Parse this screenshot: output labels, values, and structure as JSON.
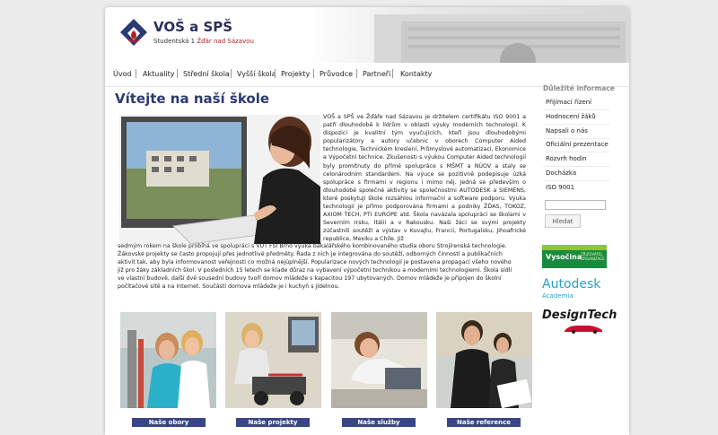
{
  "header": {
    "school_name": "VOŠ a SPŠ",
    "address_street": "Studentská 1",
    "address_town": "Žďár nad Sázavou"
  },
  "nav": [
    "Úvod",
    "Aktuality",
    "Střední škola",
    "Vyšší škola",
    "Projekty",
    "Průvodce",
    "Partneři",
    "Kontakty"
  ],
  "main": {
    "heading": "Vítejte na naší škole",
    "intro_right": "VOŠ a SPŠ ve Žďáře nad Sázavou je držitelem certifikátu ISO 9001 a patří dlouhodobě k lídrům v oblasti výuky moderních technologií. K dispozici je kvalitní tým vyučujících, kteří jsou dlouhodobými popularizátory a autory učebnic v oborech Computer Aided technologie, Technickém kreslení, Průmyslové automatizaci, Ekonomice a Výpočetní technice. Zkušenosti s výukou Computer Aided technologií byly promítnuty do přímé spolupráce s MŠMT a NÚOV a staly se celonárodním standardem. Na výuce se pozitivně podepisuje úzká spolupráce s firmami v regionu i mimo něj. Jedná se především o dlouhodobé společné aktivity se společnostmi AUTODESK a SIEMENS, které poskytují škole rozsáhlou informační a software podporu. Výuka technologií je přímo podporována firmami a podniky ŽĎAS, TOKOZ, AXIOM TECH, PTI EUROPE atd. Škola navázala spolupráci se školami v Severním Irsku, Itálii a v Rakousku. Naši žáci se svými projekty zúčastnili soutěží a výstav v Kuvajtu, Francii, Portugalsku, Jihoafrické republice, Mexiku a Chile. Již",
    "intro_full_lines": [
      "sedmým rokem na škole probíhá ve spolupráci s VUT FSI Brno výuka bakalářského kombinovaného studia oboru Strojírenská technologie.",
      "Žákovské projekty se často propojují přes jednotlivé předměty. Řada z nich je integrována do soutěží, odborných činností a publikačních",
      "aktivit tak, aby byla informovanost veřejnosti co možná nejúplnější. Popularizace nových technologií je postavena propagací všeho nového",
      "již pro žáky základních škol. V posledních 15 letech se klade důraz na vybavení výpočetní technikou a moderními technologiemi. Škola sídlí",
      "ve vlastní budově, další dvě sousední budovy tvoří domov mládeže s kapacitou 197 ubytovaných. Domov mládeže je připojen do školní",
      "počítačové sítě a na Internet. Součástí domova mládeže je i kuchyň s jídelnou."
    ],
    "tiles": [
      {
        "label": "Naše obory"
      },
      {
        "label": "Naše projekty"
      },
      {
        "label": "Naše služby"
      },
      {
        "label": "Naše reference"
      }
    ]
  },
  "sidebar": {
    "title": "Důležité informace",
    "items": [
      "Přijímací řízení",
      "Hodnocení žáků",
      "Napsali o nás",
      "Oficiální prezentace",
      "Rozvrh hodin",
      "Docházka",
      "ISO 9001"
    ],
    "search_value": "",
    "search_button": "Hledat",
    "partners": {
      "vysocina": "Vysočina",
      "vysocina_tag1": "ZŘIZOVATEL",
      "vysocina_tag2": "ORGANIZACE",
      "autodesk": "Autodesk",
      "autodesk_sub": "Academia",
      "designtech": "DesignTech"
    }
  },
  "colors": {
    "brand_navy": "#2b3a70",
    "button_navy": "#3a4587",
    "accent_red": "#b3202a",
    "vysocina_green": "#1a8a3e",
    "autodesk_blue": "#2aa0c7"
  }
}
